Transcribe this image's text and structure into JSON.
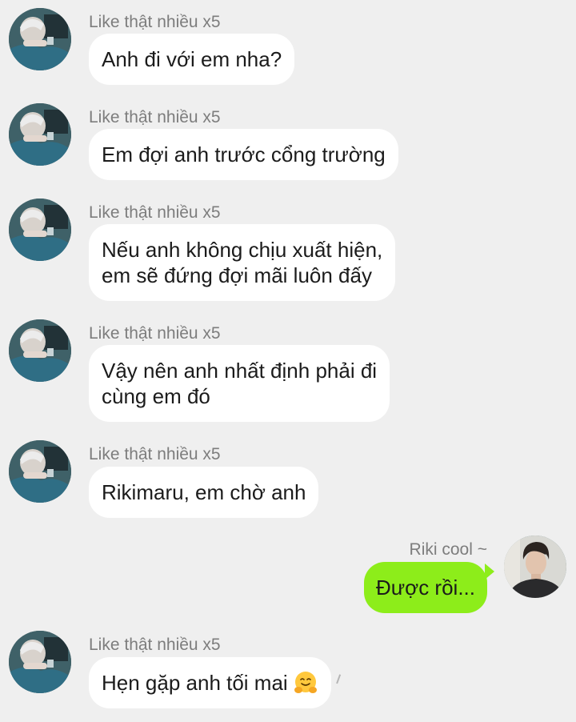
{
  "contacts": {
    "other_name": "Like thật nhiều x5",
    "self_name": "Riki cool ~"
  },
  "messages": [
    {
      "sender": "Like thật nhiều x5",
      "lines": [
        "Anh đi với em nha?"
      ]
    },
    {
      "sender": "Like thật nhiều x5",
      "lines": [
        "Em đợi anh trước cổng trường"
      ]
    },
    {
      "sender": "Like thật nhiều x5",
      "lines": [
        "Nếu anh không chịu xuất hiện,",
        "em sẽ đứng đợi mãi luôn đấy"
      ]
    },
    {
      "sender": "Like thật nhiều x5",
      "lines": [
        "Vậy nên anh nhất định phải đi",
        "cùng em đó"
      ]
    },
    {
      "sender": "Like thật nhiều x5",
      "lines": [
        "Rikimaru, em chờ anh"
      ]
    },
    {
      "sender": "Riki cool ~",
      "lines": [
        "Được rồi..."
      ]
    },
    {
      "sender": "Like thật nhiều x5",
      "lines": [
        "Hẹn gặp anh tối mai"
      ],
      "emoji": "hugging-face"
    }
  ],
  "colors": {
    "background": "#efefef",
    "incoming_bubble": "#ffffff",
    "outgoing_bubble": "#8ded1a",
    "sender_text": "#7d7d7d",
    "message_text": "#1b1b1b"
  },
  "icons": {
    "avatar_other": "avatar-photo-man-blue-shirt",
    "avatar_self": "avatar-photo-man-dark-hair",
    "emoji": "hugging-face-emoji"
  }
}
